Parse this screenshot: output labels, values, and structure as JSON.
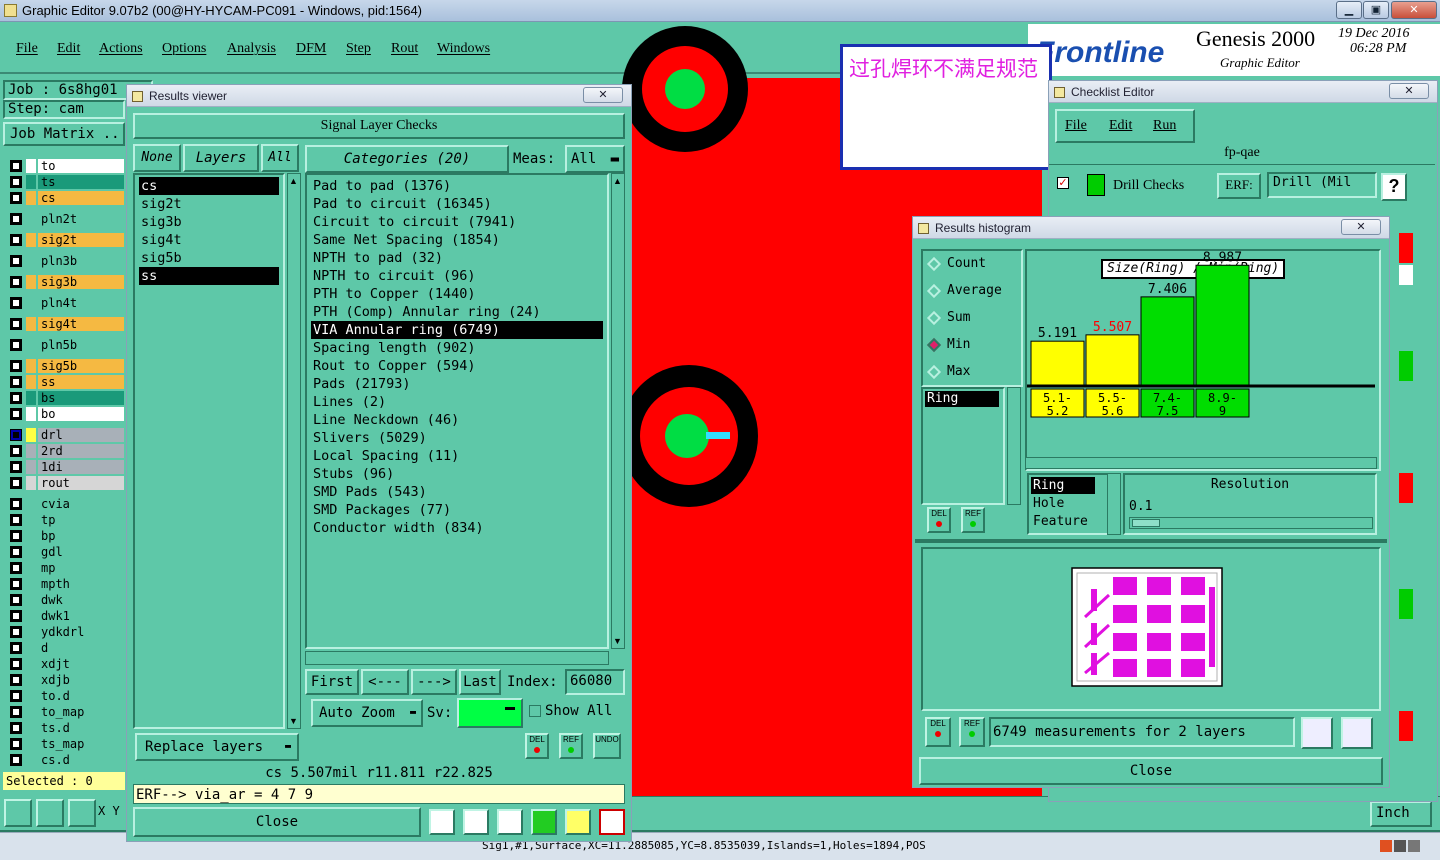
{
  "app": {
    "title": "Graphic Editor 9.07b2 (00@HY-HYCAM-PC091 - Windows, pid:1564)",
    "menu": [
      "File",
      "Edit",
      "Actions",
      "Options",
      "Analysis",
      "DFM",
      "Step",
      "Rout",
      "Windows"
    ],
    "job_label": "Job : 6s8hg01",
    "step_label": "Step: cam",
    "job_matrix": "Job Matrix ..",
    "selected": "Selected : 0",
    "status_line": "Sig1,#1,Surface,XC=11.2885085,YC=8.8535039,Islands=1,Holes=1894,POS",
    "units": "Inch",
    "xy_label": "X Y"
  },
  "brand": {
    "logo": "Frontline",
    "product": "Genesis 2000",
    "subtitle": "Graphic Editor",
    "date": "19 Dec 2016",
    "time": "06:28 PM"
  },
  "annotation": {
    "text": "过孔焊环不满足规范"
  },
  "layers": [
    {
      "name": "to",
      "color": "#ffffff",
      "checked": false
    },
    {
      "name": "ts",
      "color": "#1a9a7a",
      "checked": false
    },
    {
      "name": "cs",
      "color": "#f5b942",
      "checked": false
    },
    {
      "name": "pln2t",
      "color": "#5ec8a8",
      "checked": false
    },
    {
      "name": "sig2t",
      "color": "#f5b942",
      "checked": false
    },
    {
      "name": "pln3b",
      "color": "#5ec8a8",
      "checked": false
    },
    {
      "name": "sig3b",
      "color": "#f5b942",
      "checked": false
    },
    {
      "name": "pln4t",
      "color": "#5ec8a8",
      "checked": false
    },
    {
      "name": "sig4t",
      "color": "#f5b942",
      "checked": false
    },
    {
      "name": "pln5b",
      "color": "#5ec8a8",
      "checked": false
    },
    {
      "name": "sig5b",
      "color": "#f5b942",
      "checked": false
    },
    {
      "name": "ss",
      "color": "#f5b942",
      "checked": false
    },
    {
      "name": "bs",
      "color": "#1a9a7a",
      "checked": false
    },
    {
      "name": "bo",
      "color": "#ffffff",
      "checked": false
    },
    {
      "name": "drl",
      "color": "#a8b0b8",
      "checked": true
    },
    {
      "name": "2rd",
      "color": "#a8b0b8",
      "checked": false
    },
    {
      "name": "1di",
      "color": "#a8b0b8",
      "checked": false
    },
    {
      "name": "rout",
      "color": "#d6d6d6",
      "checked": false
    },
    {
      "name": "cvia",
      "color": "#5ec8a8",
      "checked": false
    },
    {
      "name": "tp",
      "color": "#5ec8a8",
      "checked": false
    },
    {
      "name": "bp",
      "color": "#5ec8a8",
      "checked": false
    },
    {
      "name": "gdl",
      "color": "#5ec8a8",
      "checked": false
    },
    {
      "name": "mp",
      "color": "#5ec8a8",
      "checked": false
    },
    {
      "name": "mpth",
      "color": "#5ec8a8",
      "checked": false
    },
    {
      "name": "dwk",
      "color": "#5ec8a8",
      "checked": false
    },
    {
      "name": "dwk1",
      "color": "#5ec8a8",
      "checked": false
    },
    {
      "name": "ydkdrl",
      "color": "#5ec8a8",
      "checked": false
    },
    {
      "name": "d",
      "color": "#5ec8a8",
      "checked": false
    },
    {
      "name": "xdjt",
      "color": "#5ec8a8",
      "checked": false
    },
    {
      "name": "xdjb",
      "color": "#5ec8a8",
      "checked": false
    },
    {
      "name": "to.d",
      "color": "#5ec8a8",
      "checked": false
    },
    {
      "name": "to_map",
      "color": "#5ec8a8",
      "checked": false
    },
    {
      "name": "ts.d",
      "color": "#5ec8a8",
      "checked": false
    },
    {
      "name": "ts_map",
      "color": "#5ec8a8",
      "checked": false
    },
    {
      "name": "cs.d",
      "color": "#5ec8a8",
      "checked": false
    }
  ],
  "results_viewer": {
    "title": "Results viewer",
    "close_x": "✕",
    "header": "Signal Layer Checks",
    "none_btn": "None",
    "layers_btn": "Layers",
    "all_btn": "All",
    "categories_btn": "Categories (20)",
    "meas_label": "Meas:",
    "meas_value": "All",
    "layer_list": [
      "cs",
      "sig2t",
      "sig3b",
      "sig4t",
      "sig5b",
      "ss"
    ],
    "categories": [
      "Pad to pad (1376)",
      "Pad to circuit (16345)",
      "Circuit to circuit (7941)",
      "Same Net Spacing (1854)",
      "NPTH to pad (32)",
      "NPTH to circuit (96)",
      "PTH to Copper (1440)",
      "PTH (Comp) Annular ring (24)",
      "VIA Annular ring (6749)",
      "Spacing length (902)",
      "Rout to Copper (594)",
      "Pads (21793)",
      "Lines (2)",
      "Line Neckdown (46)",
      "Slivers (5029)",
      "Local Spacing (11)",
      "Stubs (96)",
      "SMD Pads (543)",
      "SMD Packages (77)",
      "Conductor width (834)"
    ],
    "first_btn": "First",
    "prev_btn": "<---",
    "next_btn": "--->",
    "last_btn": "Last",
    "index_label": "Index:",
    "index_value": "66080",
    "auto_zoom": "Auto Zoom",
    "sv_label": "Sv:",
    "show_all": "Show All",
    "replace_layers": "Replace layers",
    "del_label": "DEL",
    "ref_label": "REF",
    "undo_label": "UNDO",
    "measure_line": "cs 5.507mil  r11.811  r22.825",
    "erf_line": "ERF--> via_ar = 4 7 9",
    "close_btn": "Close"
  },
  "checklist": {
    "title": "Checklist Editor",
    "menu": [
      "File",
      "Edit",
      "Run"
    ],
    "name": "fp-qae",
    "drill_checks": "Drill Checks",
    "erf_label": "ERF:",
    "erf_value": "Drill (Mil",
    "help": "?"
  },
  "histogram": {
    "title": "Results histogram",
    "options": [
      "Count",
      "Average",
      "Sum",
      "Min",
      "Max"
    ],
    "selected_option": "Min",
    "list_items": [
      "Ring"
    ],
    "chart_title": "Size(Ring) / Min(Ring)",
    "sort_items": [
      "Ring",
      "Hole",
      "Feature"
    ],
    "resolution_label": "Resolution",
    "resolution_value": "0.1",
    "measurements": "6749 measurements for 2 layers",
    "close_btn": "Close",
    "del_label": "DEL",
    "ref_label": "REF"
  },
  "chart_data": {
    "type": "bar",
    "title": "Size(Ring) / Min(Ring)",
    "categories": [
      "5.1-5.2",
      "5.5-5.6",
      "7.4-7.5",
      "8.9-9"
    ],
    "values": [
      5.191,
      5.507,
      7.406,
      8.987
    ],
    "value_labels": [
      "5.191",
      "5.507",
      "7.406",
      "8.987"
    ],
    "colors": [
      "#ffff00",
      "#ffff00",
      "#00dd00",
      "#00dd00"
    ],
    "label_colors": [
      "#000000",
      "#ff0000",
      "#000000",
      "#000000"
    ],
    "ylim": [
      0,
      9.5
    ]
  }
}
